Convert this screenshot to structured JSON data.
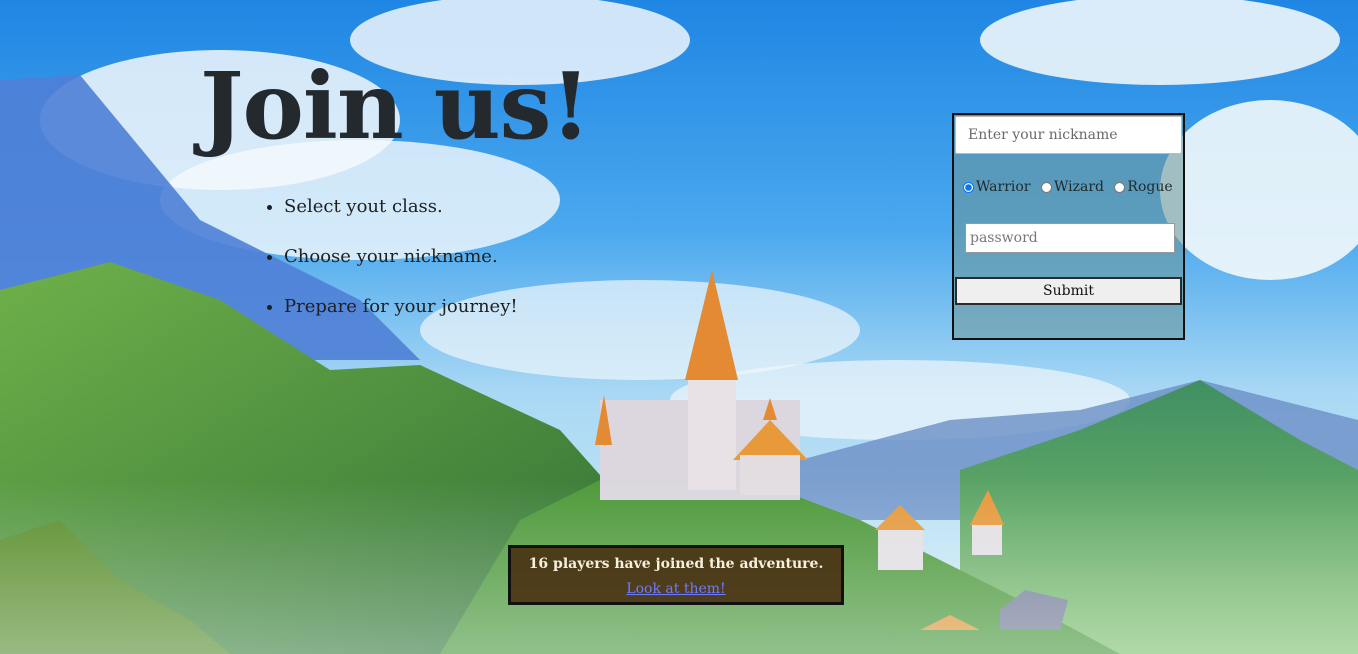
{
  "page": {
    "title": "Join us!"
  },
  "steps": [
    "Select yout class.",
    "Choose your nickname.",
    "Prepare for your journey!"
  ],
  "form": {
    "nickname_placeholder": "Enter your nickname",
    "classes": [
      {
        "label": "Warrior",
        "selected": true
      },
      {
        "label": "Wizard",
        "selected": false
      },
      {
        "label": "Rogue",
        "selected": false
      }
    ],
    "password_placeholder": "password",
    "submit_label": "Submit"
  },
  "players": {
    "message": "16 players have joined the adventure.",
    "link_label": "Look at them!"
  }
}
